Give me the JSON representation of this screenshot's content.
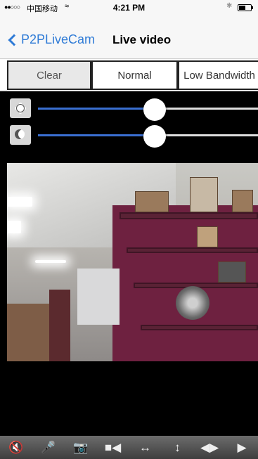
{
  "status_bar": {
    "signal": "●●○○○",
    "carrier": "中国移动",
    "wifi": "≈",
    "time": "4:21 PM",
    "bluetooth": "✱"
  },
  "nav": {
    "back_label": "P2PLiveCam",
    "title": "Live video"
  },
  "quality": {
    "options": [
      "Clear",
      "Normal",
      "Low Bandwidth"
    ],
    "selected": "Clear"
  },
  "controls": {
    "brightness_level": 0.53,
    "contrast_level": 0.53,
    "brightness_icon": "sun-icon",
    "contrast_icon": "contrast-icon"
  },
  "toolbar": {
    "buttons": [
      {
        "name": "mute-speaker-button",
        "icon": "speaker-muted-icon",
        "glyph": "🔇"
      },
      {
        "name": "microphone-button",
        "icon": "microphone-icon",
        "glyph": "🎤"
      },
      {
        "name": "snapshot-button",
        "icon": "camera-icon",
        "glyph": "📷"
      },
      {
        "name": "record-button",
        "icon": "video-camera-icon",
        "glyph": "■◀"
      },
      {
        "name": "flip-horizontal-button",
        "icon": "horizontal-arrows-icon",
        "glyph": "↔"
      },
      {
        "name": "flip-vertical-button",
        "icon": "vertical-arrows-icon",
        "glyph": "↕"
      },
      {
        "name": "mirror-button",
        "icon": "mirror-triangles-icon",
        "glyph": "◀▶"
      },
      {
        "name": "play-button",
        "icon": "play-icon",
        "glyph": "▶"
      }
    ]
  },
  "colors": {
    "ios_blue": "#2f7bd6",
    "slider_fill": "#3a6fd1",
    "record_red": "#e0262b",
    "toolbar_gray": "#555555"
  }
}
